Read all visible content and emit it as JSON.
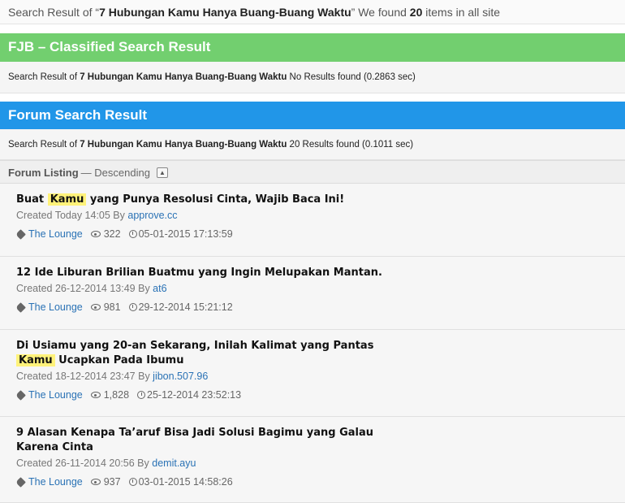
{
  "top": {
    "prefix": "Search Result of “",
    "query": "7 Hubungan Kamu Hanya Buang-Buang Waktu",
    "middle": "” We found ",
    "count": "20",
    "suffix": " items in all site"
  },
  "fjb": {
    "title": "FJB – Classified Search Result",
    "prefix": "Search Result of ",
    "query": "7 Hubungan Kamu Hanya Buang-Buang Waktu",
    "result": " No Results found (0.2863 sec)"
  },
  "forum": {
    "title": "Forum Search Result",
    "prefix": "Search Result of ",
    "query": "7 Hubungan Kamu Hanya Buang-Buang Waktu",
    "result": " 20 Results found (0.1011 sec)"
  },
  "listing": {
    "label": "Forum Listing",
    "order": " — Descending"
  },
  "threads": [
    {
      "title_pre": "Buat ",
      "title_hl": "Kamu",
      "title_post": " yang Punya Resolusi Cinta, Wajib Baca Ini!",
      "created": "Created Today 14:05 By ",
      "author": "approve.cc",
      "forum": "The Lounge",
      "views": "322",
      "last": "05-01-2015 17:13:59"
    },
    {
      "title_pre": "12 Ide Liburan Brilian Buatmu yang Ingin Melupakan Mantan.",
      "title_hl": "",
      "title_post": "",
      "created": "Created 26-12-2014 13:49 By ",
      "author": "at6",
      "forum": "The Lounge",
      "views": "981",
      "last": "29-12-2014 15:21:12"
    },
    {
      "title_pre": "Di Usiamu yang 20-an Sekarang, Inilah Kalimat yang Pantas ",
      "title_hl": "Kamu",
      "title_post": " Ucapkan Pada Ibumu",
      "created": "Created 18-12-2014 23:47 By ",
      "author": "jibon.507.96",
      "forum": "The Lounge",
      "views": "1,828",
      "last": "25-12-2014 23:52:13"
    },
    {
      "title_pre": "9 Alasan Kenapa Ta’aruf Bisa Jadi Solusi Bagimu yang Galau Karena Cinta",
      "title_hl": "",
      "title_post": "",
      "created": "Created 26-11-2014 20:56 By ",
      "author": "demit.ayu",
      "forum": "The Lounge",
      "views": "937",
      "last": "03-01-2015 14:58:26"
    }
  ],
  "colors": {
    "fjb_banner": "#72cf6f",
    "forum_banner": "#2196e8",
    "highlight": "#fff27a",
    "link": "#2a72b5"
  }
}
